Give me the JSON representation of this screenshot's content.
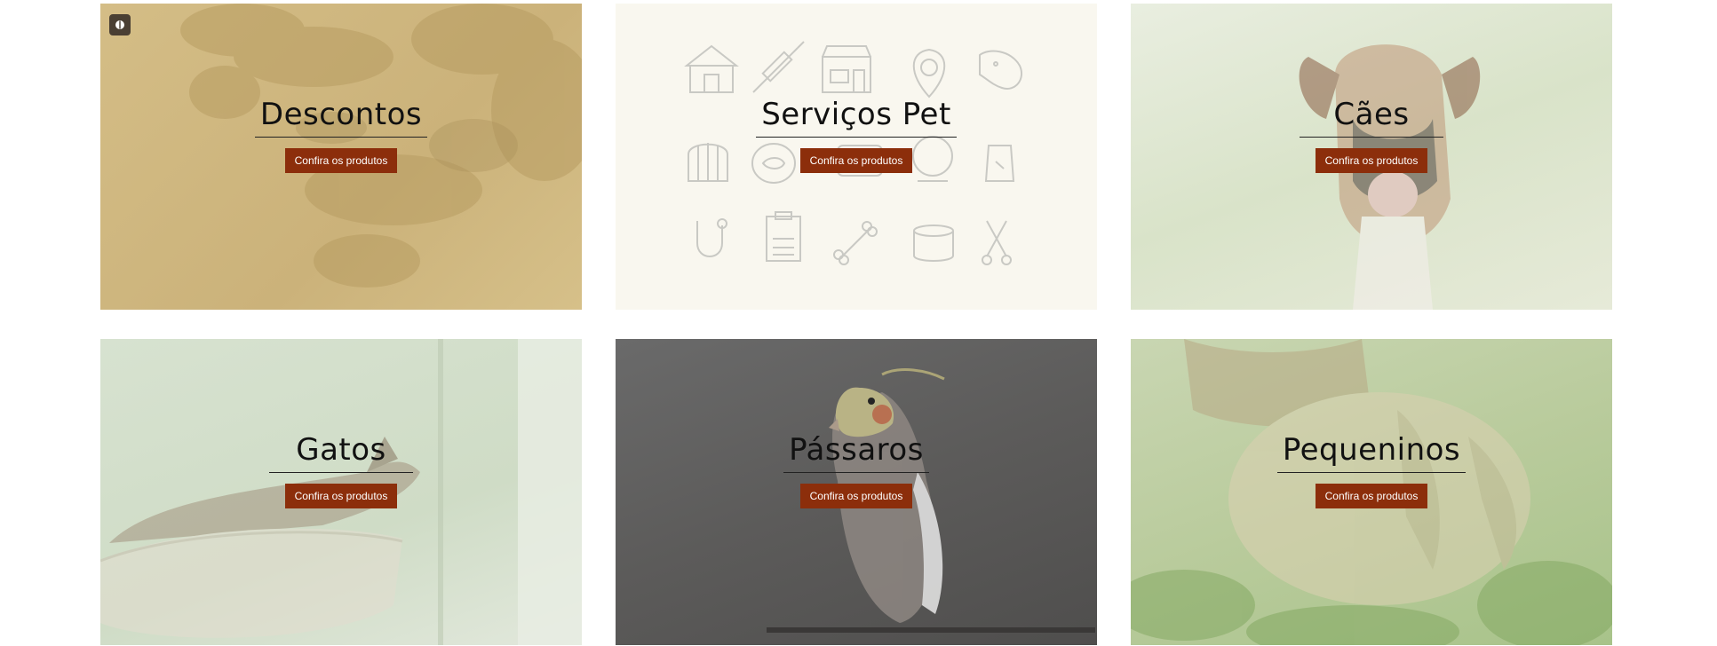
{
  "cards": [
    {
      "title": "Descontos",
      "cta": "Confira os produtos"
    },
    {
      "title": "Serviços Pet",
      "cta": "Confira os produtos"
    },
    {
      "title": "Cães",
      "cta": "Confira os produtos"
    },
    {
      "title": "Gatos",
      "cta": "Confira os produtos"
    },
    {
      "title": "Pássaros",
      "cta": "Confira os produtos"
    },
    {
      "title": "Pequeninos",
      "cta": "Confira os produtos"
    }
  ],
  "colors": {
    "cta_background": "#8c2e0b",
    "cta_text": "#ffffff",
    "title_text": "#111111"
  },
  "icons": {
    "accessibility_button": "accessibility-icon",
    "servicos_icons": [
      "dog-house-icon",
      "syringe-icon",
      "pet-shop-icon",
      "map-pin-paw-icon",
      "dog-head-icon",
      "bird-cage-icon",
      "fish-bowl-icon",
      "pet-bed-icon",
      "hamster-wheel-icon",
      "pet-food-bag-icon",
      "stethoscope-icon",
      "clipboard-paw-icon",
      "bone-icon",
      "pet-food-can-icon",
      "scissors-icon"
    ]
  }
}
